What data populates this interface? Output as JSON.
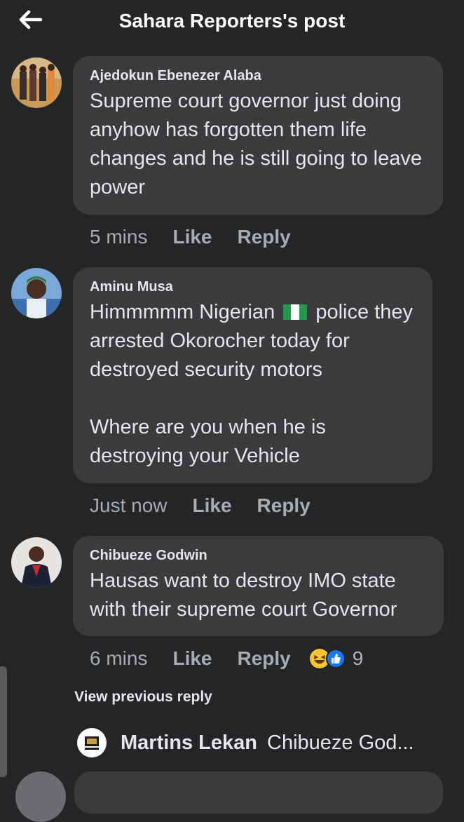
{
  "header": {
    "back_icon": "arrow-left-icon",
    "title": "Sahara Reporters's post"
  },
  "comments": [
    {
      "author": "Ajedokun Ebenezer Alaba",
      "text": "Supreme court governor just doing anyhow has forgotten them life changes and he is still going to leave power",
      "time": "5 mins",
      "like": "Like",
      "reply": "Reply"
    },
    {
      "author": "Aminu Musa",
      "text_line1": "Himmmmm Nigerian",
      "flag_icon": "nigeria-flag-icon",
      "text_line1_cont": "police they arrested Okorocher today for destroyed security motors",
      "text_para2": "Where are you when he is destroying your Vehicle",
      "time": "Just now",
      "like": "Like",
      "reply": "Reply"
    },
    {
      "author": "Chibueze Godwin",
      "text": "Hausas want to destroy IMO state with their supreme court Governor",
      "time": "6 mins",
      "like": "Like",
      "reply": "Reply",
      "reactions": [
        "haha-icon",
        "like-reaction-icon"
      ],
      "reaction_count": "9"
    }
  ],
  "view_previous": "View previous reply",
  "reply_preview": {
    "author": "Martins Lekan",
    "snippet": "Chibueze God..."
  },
  "colors": {
    "background": "#242526",
    "bubble": "#3a3b3c",
    "text": "#e4e6eb",
    "meta": "#a8abaf"
  }
}
